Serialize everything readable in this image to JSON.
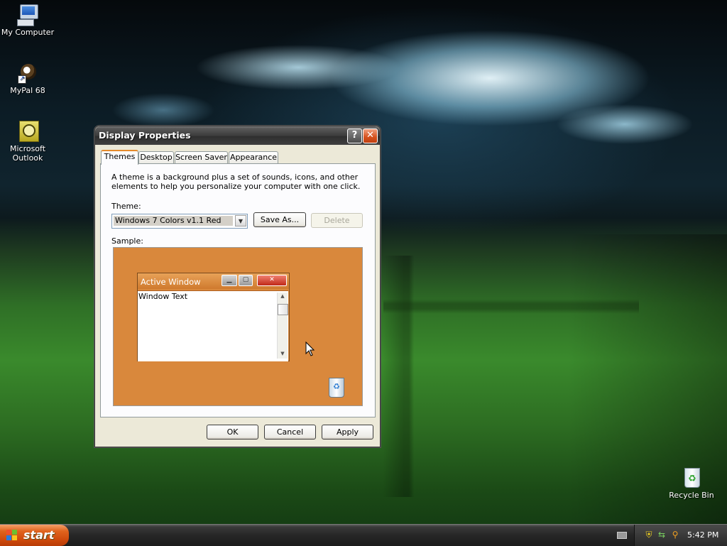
{
  "desktop": {
    "icons": [
      {
        "label": "My Computer",
        "icon": "computer-icon"
      },
      {
        "label": "MyPal 68",
        "icon": "mypal-icon"
      },
      {
        "label": "Microsoft Outlook",
        "label_line1": "Microsoft",
        "label_line2": "Outlook",
        "icon": "outlook-icon"
      },
      {
        "label": "Recycle Bin",
        "icon": "recycle-bin-icon"
      }
    ]
  },
  "dialog": {
    "title": "Display Properties",
    "help_glyph": "?",
    "close_glyph": "✕",
    "tabs": [
      {
        "label": "Themes",
        "active": true
      },
      {
        "label": "Desktop",
        "active": false
      },
      {
        "label": "Screen Saver",
        "active": false
      },
      {
        "label": "Appearance",
        "active": false
      }
    ],
    "description": "A theme is a background plus a set of sounds, icons, and other elements to help you personalize your computer with one click.",
    "theme_label": "Theme:",
    "theme_value": "Windows 7 Colors v1.1 Red",
    "save_as_label": "Save As...",
    "delete_label": "Delete",
    "sample_label": "Sample:",
    "sample": {
      "window_title": "Active Window",
      "window_text": "Window Text",
      "background_color": "#d9883c"
    },
    "ok_label": "OK",
    "cancel_label": "Cancel",
    "apply_label": "Apply"
  },
  "taskbar": {
    "start_label": "start",
    "clock": "5:42 PM"
  },
  "colors": {
    "start_button": "#e0641e",
    "titlebar": "#3c3c3c",
    "active_tab_accent": "#e68b2c"
  }
}
